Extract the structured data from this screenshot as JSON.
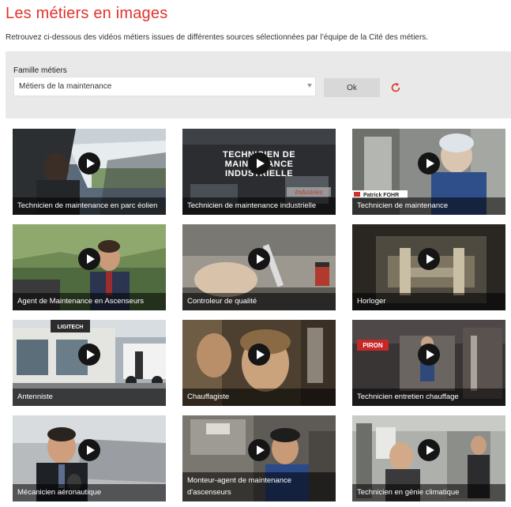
{
  "page": {
    "title": "Les métiers en images",
    "intro": "Retrouvez ci-dessous des vidéos métiers issues de différentes sources sélectionnées par l’équipe de la Cité des métiers."
  },
  "filter": {
    "label": "Famille métiers",
    "selected": "Métiers de la maintenance",
    "ok_label": "Ok",
    "reset_icon": "refresh-icon"
  },
  "colors": {
    "accent": "#e1332b",
    "panel": "#e9e9e9",
    "button": "#d8d8d8"
  },
  "videos": [
    {
      "caption": "Technicien de maintenance en parc éolien"
    },
    {
      "caption": "Technicien de maintenance industrielle"
    },
    {
      "caption": "Technicien de maintenance"
    },
    {
      "caption": "Agent de Maintenance en Ascenseurs"
    },
    {
      "caption": "Controleur de qualité"
    },
    {
      "caption": "Horloger"
    },
    {
      "caption": "Antenniste"
    },
    {
      "caption": "Chauffagiste"
    },
    {
      "caption": "Technicien entretien chauffage"
    },
    {
      "caption": "Mécanicien aéronautique"
    },
    {
      "caption": "Monteur-agent de maintenance d'ascenseurs"
    },
    {
      "caption": "Technicien en génie climatique"
    }
  ],
  "thumb_texts": {
    "v2_overlay": "TECHNICIEN DE\nMAINTENANCE\nINDUSTRIELLE",
    "v2_brand": "Industries",
    "v3_name": "Patrick FOHR",
    "v7_sign": "LIGITECH",
    "v9_sign": "PIRON"
  }
}
